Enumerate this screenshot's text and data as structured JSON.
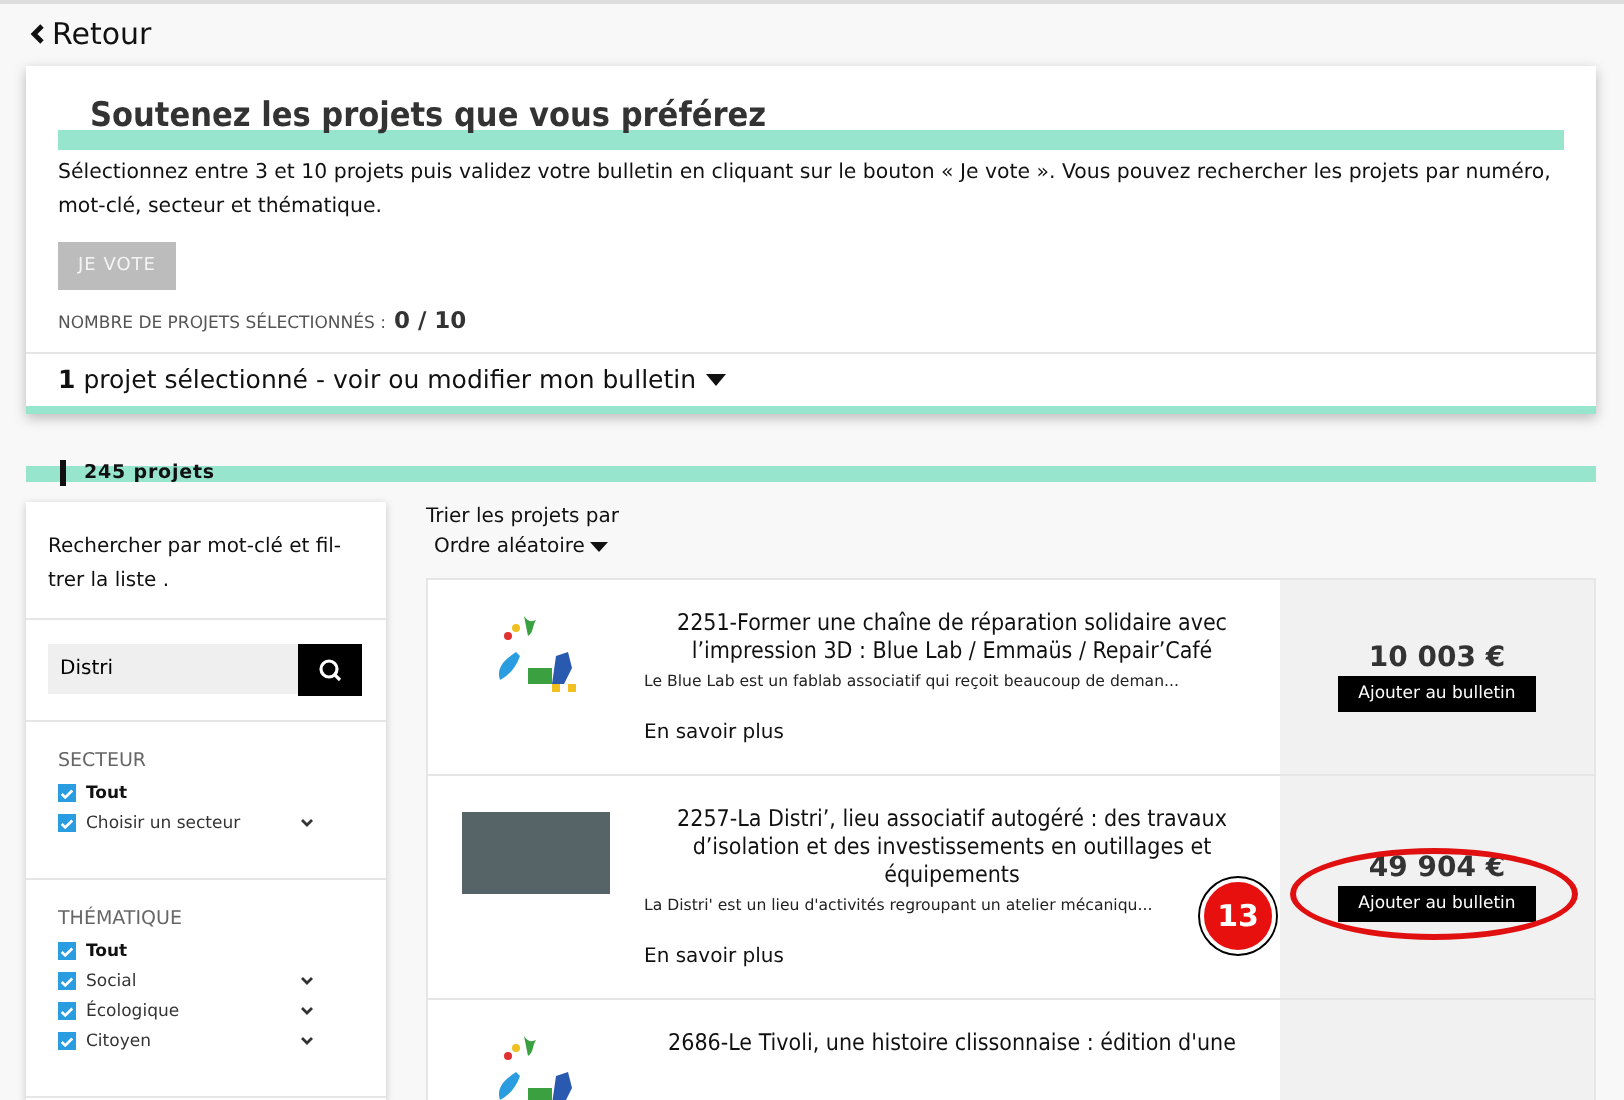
{
  "back_link": {
    "label": "Retour"
  },
  "intro": {
    "title": "Soutenez les projets que vous préférez",
    "text": "Sélectionnez entre 3 et 10 projets puis validez votre bulletin en cliquant sur le bouton « Je vote ». Vous pouvez rechercher les projets par numéro, mot-clé, secteur et thématique.",
    "vote_button": {
      "label": "JE VOTE",
      "disabled": true
    },
    "count_label": "NOMBRE DE PROJETS SÉLECTIONNÉS :",
    "count_value": "0 / 10",
    "selection_toggle": {
      "count": "1",
      "label": "projet sélectionné - voir ou modifier mon bulletin",
      "expanded": false
    }
  },
  "results": {
    "count": "245 projets"
  },
  "sidebar": {
    "intro": "Rechercher par mot-clé et fil-trer la liste .",
    "search": {
      "value": "Distri"
    },
    "groups": [
      {
        "title": "SECTEUR",
        "options": [
          {
            "label": "Tout",
            "checked": true,
            "bold": true,
            "expandable": false
          },
          {
            "label": "Choisir un secteur",
            "checked": true,
            "bold": false,
            "expandable": true
          }
        ]
      },
      {
        "title": "THÉMATIQUE",
        "options": [
          {
            "label": "Tout",
            "checked": true,
            "bold": true,
            "expandable": false
          },
          {
            "label": "Social",
            "checked": true,
            "bold": false,
            "expandable": true
          },
          {
            "label": "Écologique",
            "checked": true,
            "bold": false,
            "expandable": true
          },
          {
            "label": "Citoyen",
            "checked": true,
            "bold": false,
            "expandable": true
          }
        ]
      }
    ]
  },
  "sort": {
    "label": "Trier les projets par",
    "value": "Ordre aléatoire"
  },
  "projects": [
    {
      "kind": "illustration",
      "title": "2251-Former une chaîne de réparation solidaire avec l’impression 3D : Blue Lab / Emmaüs / Repair’Café",
      "summary": "Le Blue Lab est un fablab associatif qui reçoit beaucoup de deman...",
      "link": "En savoir plus",
      "amount": "10 003 €",
      "add_button": "Ajouter au bulletin",
      "highlighted": false
    },
    {
      "kind": "photo",
      "title": "2257-La Distri’, lieu associatif autogéré : des travaux d’isolation et des investissements en outillages et équipements",
      "summary": "La Distri' est un lieu d'activités regroupant un atelier mécaniqu...",
      "link": "En savoir plus",
      "amount": "49 904 €",
      "add_button": "Ajouter au bulletin",
      "highlighted": true,
      "marker": "13"
    },
    {
      "kind": "illustration",
      "title": "2686-Le Tivoli, une histoire clissonnaise : édition d'une",
      "highlighted": false
    }
  ]
}
